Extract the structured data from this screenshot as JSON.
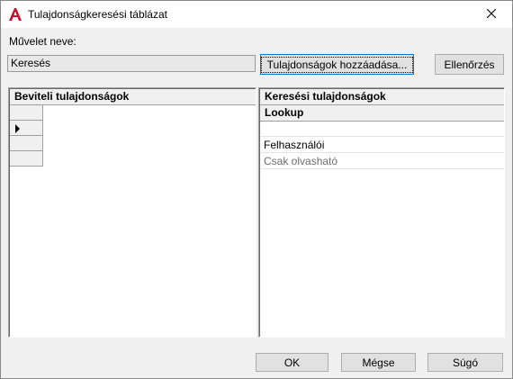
{
  "window": {
    "title": "Tulajdonságkeresési táblázat",
    "icon": "autocad-a-icon",
    "close_icon": "close-icon"
  },
  "colors": {
    "icon_red": "#c8102e",
    "focus_blue": "#0078d7",
    "muted_text": "#6d6d6d"
  },
  "operation": {
    "label": "Művelet neve:",
    "value": "Keresés"
  },
  "buttons": {
    "add_properties": "Tulajdonságok hozzáadása...",
    "check": "Ellenőrzés",
    "ok": "OK",
    "cancel": "Mégse",
    "help": "Súgó"
  },
  "input_panel": {
    "header": "Beviteli tulajdonságok",
    "row_count": 4,
    "current_row": 2
  },
  "lookup_panel": {
    "header": "Keresési tulajdonságok",
    "column": "Lookup",
    "rows": [
      "",
      "Felhasználói",
      "Csak olvasható"
    ]
  }
}
